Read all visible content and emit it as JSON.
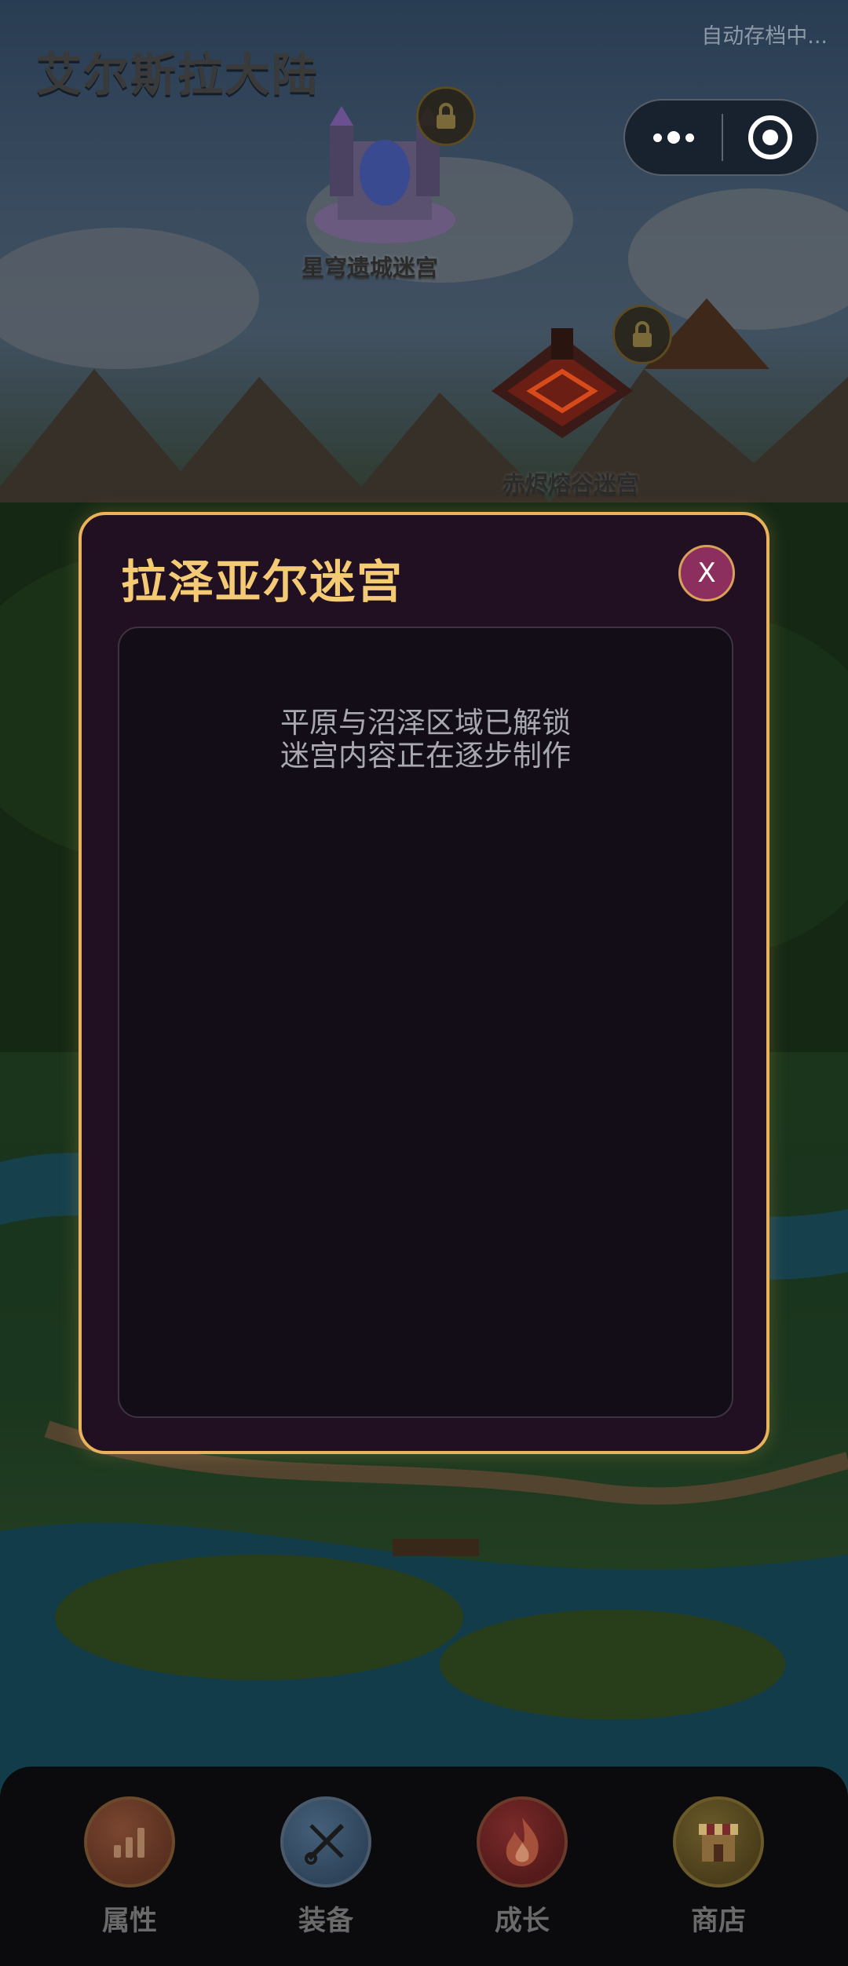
{
  "header": {
    "title": "艾尔斯拉大陆",
    "autosave": "自动存档中..."
  },
  "capsule": {
    "more_icon": "more-dots-icon",
    "close_icon": "target-circle-icon"
  },
  "map": {
    "nodes": [
      {
        "label": "星穹遗城迷宫",
        "locked": true,
        "icon": "lock-icon"
      },
      {
        "label": "赤烬熔谷迷宫",
        "locked": true,
        "icon": "lock-icon"
      }
    ]
  },
  "modal": {
    "title": "拉泽亚尔迷宫",
    "close_label": "X",
    "notice_line1": "平原与沼泽区域已解锁",
    "notice_line2": "迷宫内容正在逐步制作"
  },
  "nav": {
    "items": [
      {
        "label": "属性",
        "icon": "bar-chart-icon"
      },
      {
        "label": "装备",
        "icon": "crossed-tools-icon"
      },
      {
        "label": "成长",
        "icon": "flame-icon"
      },
      {
        "label": "商店",
        "icon": "shop-icon"
      }
    ]
  },
  "colors": {
    "accent_gold": "#e8b35a",
    "modal_bg": "#201022",
    "close_button": "#8c2f5e"
  }
}
